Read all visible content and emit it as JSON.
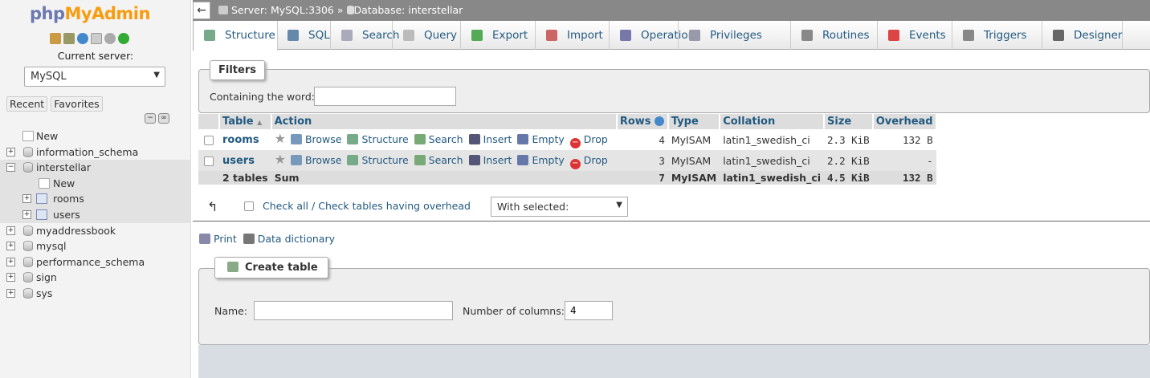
{
  "nav": {
    "logo_php": "php",
    "logo_myadmin": "MyAdmin",
    "current_server_label": "Current server:",
    "server_select": "MySQL",
    "recent_tab": "Recent",
    "favorites_tab": "Favorites",
    "tree": [
      {
        "label": "New",
        "kind": "new",
        "level": 0
      },
      {
        "label": "information_schema",
        "kind": "db",
        "level": 0
      },
      {
        "label": "interstellar",
        "kind": "db-open",
        "level": 0
      },
      {
        "label": "New",
        "kind": "new",
        "level": 1
      },
      {
        "label": "rooms",
        "kind": "table",
        "level": 1
      },
      {
        "label": "users",
        "kind": "table",
        "level": 1
      },
      {
        "label": "myaddressbook",
        "kind": "db",
        "level": 0
      },
      {
        "label": "mysql",
        "kind": "db",
        "level": 0
      },
      {
        "label": "performance_schema",
        "kind": "db",
        "level": 0
      },
      {
        "label": "sign",
        "kind": "db",
        "level": 0
      },
      {
        "label": "sys",
        "kind": "db",
        "level": 0
      }
    ]
  },
  "breadcrumb": {
    "server": "Server: MySQL:3306",
    "separator": "»",
    "database": "Database: interstellar"
  },
  "tabs": [
    {
      "label": "Structure",
      "icon": "structure-icon",
      "active": true
    },
    {
      "label": "SQL",
      "icon": "sql-icon"
    },
    {
      "label": "Search",
      "icon": "search-icon"
    },
    {
      "label": "Query",
      "icon": "query-icon"
    },
    {
      "label": "Export",
      "icon": "export-icon"
    },
    {
      "label": "Import",
      "icon": "import-icon"
    },
    {
      "label": "Operations",
      "icon": "wrench-icon"
    },
    {
      "label": "Privileges",
      "icon": "privileges-icon"
    },
    {
      "label": "Routines",
      "icon": "routines-icon"
    },
    {
      "label": "Events",
      "icon": "clock-icon"
    },
    {
      "label": "Triggers",
      "icon": "triggers-icon"
    },
    {
      "label": "Designer",
      "icon": "designer-icon"
    }
  ],
  "filters": {
    "legend": "Filters",
    "label": "Containing the word:",
    "value": ""
  },
  "table": {
    "headers": [
      "Table",
      "Action",
      "Rows",
      "Type",
      "Collation",
      "Size",
      "Overhead"
    ],
    "sort_indicator": "▲",
    "actions": [
      "Browse",
      "Structure",
      "Search",
      "Insert",
      "Empty",
      "Drop"
    ],
    "rows": [
      {
        "name": "rooms",
        "rows": "4",
        "type": "MyISAM",
        "collation": "latin1_swedish_ci",
        "size": "2.3 KiB",
        "overhead": "132 B"
      },
      {
        "name": "users",
        "rows": "3",
        "type": "MyISAM",
        "collation": "latin1_swedish_ci",
        "size": "2.2 KiB",
        "overhead": "-"
      }
    ],
    "sum": {
      "name": "2 tables",
      "label": "Sum",
      "rows": "7",
      "type": "MyISAM",
      "collation": "latin1_swedish_ci",
      "size": "4.5 KiB",
      "overhead": "132 B"
    }
  },
  "bulk": {
    "check_all": "Check all",
    "separator": "/",
    "check_overhead": "Check tables having overhead",
    "with_selected": "With selected:"
  },
  "links": {
    "print": "Print",
    "data_dictionary": "Data dictionary"
  },
  "create_table": {
    "legend": "Create table",
    "name_label": "Name:",
    "name_value": "",
    "columns_label": "Number of columns:",
    "columns_value": "4"
  },
  "colors": {
    "link": "#235a81",
    "breadcrumb_bg": "#888888",
    "logo_php": "#6c78af",
    "logo_myadmin": "#f89c0e"
  }
}
